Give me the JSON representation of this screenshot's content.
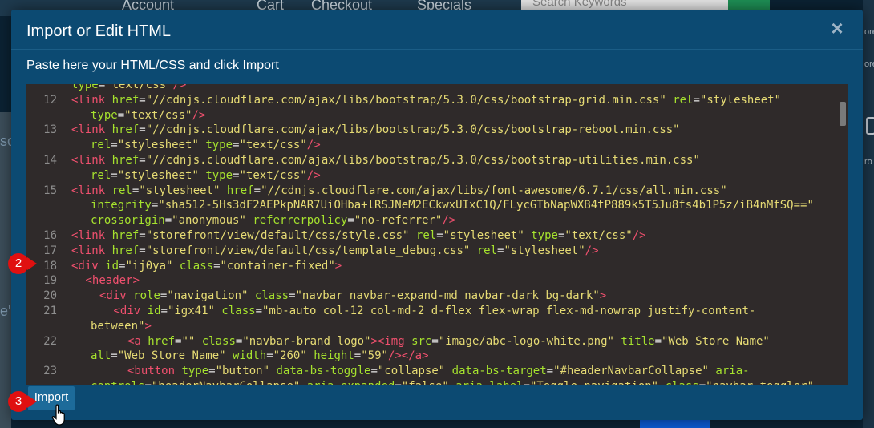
{
  "background": {
    "nav_items": [
      "Account",
      "Cart",
      "Checkout",
      "Specials"
    ],
    "search_placeholder": "Search Keywords",
    "left_fragments": [
      "sc",
      "e'"
    ],
    "right_fragments": [
      "ore",
      "ore",
      "ro"
    ]
  },
  "modal": {
    "title": "Import or Edit HTML",
    "subtitle": "Paste here your HTML/CSS and click Import",
    "close_label": "×",
    "import_label": "Import"
  },
  "steps": [
    "2",
    "3"
  ],
  "editor": {
    "lines": [
      {
        "n": "",
        "parts": [
          [
            "attr",
            "type"
          ],
          [
            "txt",
            "="
          ],
          [
            "str",
            "\"text/css\""
          ],
          [
            "tag",
            "/>"
          ]
        ]
      },
      {
        "n": "12",
        "parts": [
          [
            "tag",
            "<link "
          ],
          [
            "attr",
            "href"
          ],
          [
            "txt",
            "="
          ],
          [
            "str",
            "\"//cdnjs.cloudflare.com/ajax/libs/bootstrap/5.3.0/css/bootstrap-grid.min.css\""
          ],
          [
            "txt",
            " "
          ],
          [
            "attr",
            "rel"
          ],
          [
            "txt",
            "="
          ],
          [
            "str",
            "\"stylesheet\""
          ]
        ]
      },
      {
        "n": "",
        "cont": true,
        "parts": [
          [
            "attr",
            "type"
          ],
          [
            "txt",
            "="
          ],
          [
            "str",
            "\"text/css\""
          ],
          [
            "tag",
            "/>"
          ]
        ]
      },
      {
        "n": "13",
        "parts": [
          [
            "tag",
            "<link "
          ],
          [
            "attr",
            "href"
          ],
          [
            "txt",
            "="
          ],
          [
            "str",
            "\"//cdnjs.cloudflare.com/ajax/libs/bootstrap/5.3.0/css/bootstrap-reboot.min.css\""
          ]
        ]
      },
      {
        "n": "",
        "cont": true,
        "parts": [
          [
            "attr",
            "rel"
          ],
          [
            "txt",
            "="
          ],
          [
            "str",
            "\"stylesheet\""
          ],
          [
            "txt",
            " "
          ],
          [
            "attr",
            "type"
          ],
          [
            "txt",
            "="
          ],
          [
            "str",
            "\"text/css\""
          ],
          [
            "tag",
            "/>"
          ]
        ]
      },
      {
        "n": "14",
        "parts": [
          [
            "tag",
            "<link "
          ],
          [
            "attr",
            "href"
          ],
          [
            "txt",
            "="
          ],
          [
            "str",
            "\"//cdnjs.cloudflare.com/ajax/libs/bootstrap/5.3.0/css/bootstrap-utilities.min.css\""
          ]
        ]
      },
      {
        "n": "",
        "cont": true,
        "parts": [
          [
            "attr",
            "rel"
          ],
          [
            "txt",
            "="
          ],
          [
            "str",
            "\"stylesheet\""
          ],
          [
            "txt",
            " "
          ],
          [
            "attr",
            "type"
          ],
          [
            "txt",
            "="
          ],
          [
            "str",
            "\"text/css\""
          ],
          [
            "tag",
            "/>"
          ]
        ]
      },
      {
        "n": "15",
        "parts": [
          [
            "tag",
            "<link "
          ],
          [
            "attr",
            "rel"
          ],
          [
            "txt",
            "="
          ],
          [
            "str",
            "\"stylesheet\""
          ],
          [
            "txt",
            " "
          ],
          [
            "attr",
            "href"
          ],
          [
            "txt",
            "="
          ],
          [
            "str",
            "\"//cdnjs.cloudflare.com/ajax/libs/font-awesome/6.7.1/css/all.min.css\""
          ]
        ]
      },
      {
        "n": "",
        "cont": true,
        "parts": [
          [
            "attr",
            "integrity"
          ],
          [
            "txt",
            "="
          ],
          [
            "str",
            "\"sha512-5Hs3dF2AEPkpNAR7UiOHba+lRSJNeM2ECkwxUIxC1Q/FLycGTbNapWXB4tP889k5T5Ju8fs4b1P5z/iB4nMfSQ==\""
          ]
        ]
      },
      {
        "n": "",
        "cont": true,
        "parts": [
          [
            "attr",
            "crossorigin"
          ],
          [
            "txt",
            "="
          ],
          [
            "str",
            "\"anonymous\""
          ],
          [
            "txt",
            " "
          ],
          [
            "attr",
            "referrerpolicy"
          ],
          [
            "txt",
            "="
          ],
          [
            "str",
            "\"no-referrer\""
          ],
          [
            "tag",
            "/>"
          ]
        ]
      },
      {
        "n": "16",
        "parts": [
          [
            "tag",
            "<link "
          ],
          [
            "attr",
            "href"
          ],
          [
            "txt",
            "="
          ],
          [
            "str",
            "\"storefront/view/default/css/style.css\""
          ],
          [
            "txt",
            " "
          ],
          [
            "attr",
            "rel"
          ],
          [
            "txt",
            "="
          ],
          [
            "str",
            "\"stylesheet\""
          ],
          [
            "txt",
            " "
          ],
          [
            "attr",
            "type"
          ],
          [
            "txt",
            "="
          ],
          [
            "str",
            "\"text/css\""
          ],
          [
            "tag",
            "/>"
          ]
        ]
      },
      {
        "n": "17",
        "parts": [
          [
            "tag",
            "<link "
          ],
          [
            "attr",
            "href"
          ],
          [
            "txt",
            "="
          ],
          [
            "str",
            "\"storefront/view/default/css/template_debug.css\""
          ],
          [
            "txt",
            " "
          ],
          [
            "attr",
            "rel"
          ],
          [
            "txt",
            "="
          ],
          [
            "str",
            "\"stylesheet\""
          ],
          [
            "tag",
            "/>"
          ]
        ]
      },
      {
        "n": "18",
        "parts": [
          [
            "tag",
            "<div "
          ],
          [
            "attr",
            "id"
          ],
          [
            "txt",
            "="
          ],
          [
            "str",
            "\"ij0ya\""
          ],
          [
            "txt",
            " "
          ],
          [
            "attr",
            "class"
          ],
          [
            "txt",
            "="
          ],
          [
            "str",
            "\"container-fixed\""
          ],
          [
            "tag",
            ">"
          ]
        ]
      },
      {
        "n": "19",
        "indent": 1,
        "parts": [
          [
            "tag",
            "<header>"
          ]
        ]
      },
      {
        "n": "20",
        "indent": 2,
        "parts": [
          [
            "tag",
            "<div "
          ],
          [
            "attr",
            "role"
          ],
          [
            "txt",
            "="
          ],
          [
            "str",
            "\"navigation\""
          ],
          [
            "txt",
            " "
          ],
          [
            "attr",
            "class"
          ],
          [
            "txt",
            "="
          ],
          [
            "str",
            "\"navbar navbar-expand-md navbar-dark bg-dark\""
          ],
          [
            "tag",
            ">"
          ]
        ]
      },
      {
        "n": "21",
        "indent": 3,
        "parts": [
          [
            "tag",
            "<div "
          ],
          [
            "attr",
            "id"
          ],
          [
            "txt",
            "="
          ],
          [
            "str",
            "\"igx41\""
          ],
          [
            "txt",
            " "
          ],
          [
            "attr",
            "class"
          ],
          [
            "txt",
            "="
          ],
          [
            "str",
            "\"mb-auto col-12 col-md-2 d-flex flex-wrap flex-md-nowrap justify-content-"
          ]
        ]
      },
      {
        "n": "",
        "cont": true,
        "parts": [
          [
            "str",
            "between\""
          ],
          [
            "tag",
            ">"
          ]
        ]
      },
      {
        "n": "22",
        "indent": 4,
        "parts": [
          [
            "tag",
            "<a "
          ],
          [
            "attr",
            "href"
          ],
          [
            "txt",
            "="
          ],
          [
            "str",
            "\"\""
          ],
          [
            "txt",
            " "
          ],
          [
            "attr",
            "class"
          ],
          [
            "txt",
            "="
          ],
          [
            "str",
            "\"navbar-brand logo\""
          ],
          [
            "tag",
            "><img "
          ],
          [
            "attr",
            "src"
          ],
          [
            "txt",
            "="
          ],
          [
            "str",
            "\"image/abc-logo-white.png\""
          ],
          [
            "txt",
            " "
          ],
          [
            "attr",
            "title"
          ],
          [
            "txt",
            "="
          ],
          [
            "str",
            "\"Web Store Name\""
          ]
        ]
      },
      {
        "n": "",
        "cont": true,
        "parts": [
          [
            "attr",
            "alt"
          ],
          [
            "txt",
            "="
          ],
          [
            "str",
            "\"Web Store Name\""
          ],
          [
            "txt",
            " "
          ],
          [
            "attr",
            "width"
          ],
          [
            "txt",
            "="
          ],
          [
            "str",
            "\"260\""
          ],
          [
            "txt",
            " "
          ],
          [
            "attr",
            "height"
          ],
          [
            "txt",
            "="
          ],
          [
            "str",
            "\"59\""
          ],
          [
            "tag",
            "/></a>"
          ]
        ]
      },
      {
        "n": "23",
        "indent": 4,
        "parts": [
          [
            "tag",
            "<button "
          ],
          [
            "attr",
            "type"
          ],
          [
            "txt",
            "="
          ],
          [
            "str",
            "\"button\""
          ],
          [
            "txt",
            " "
          ],
          [
            "attr",
            "data-bs-toggle"
          ],
          [
            "txt",
            "="
          ],
          [
            "str",
            "\"collapse\""
          ],
          [
            "txt",
            " "
          ],
          [
            "attr",
            "data-bs-target"
          ],
          [
            "txt",
            "="
          ],
          [
            "str",
            "\"#headerNavbarCollapse\""
          ],
          [
            "txt",
            " "
          ],
          [
            "attr",
            "aria-"
          ]
        ]
      },
      {
        "n": "",
        "cont": true,
        "parts": [
          [
            "attr",
            "controls"
          ],
          [
            "txt",
            "="
          ],
          [
            "str",
            "\"headerNavbarCollapse\""
          ],
          [
            "txt",
            " "
          ],
          [
            "attr",
            "aria-expanded"
          ],
          [
            "txt",
            "="
          ],
          [
            "str",
            "\"false\""
          ],
          [
            "txt",
            " "
          ],
          [
            "attr",
            "aria-label"
          ],
          [
            "txt",
            "="
          ],
          [
            "str",
            "\"Toggle navigation\""
          ],
          [
            "txt",
            " "
          ],
          [
            "attr",
            "class"
          ],
          [
            "txt",
            "="
          ],
          [
            "str",
            "\"navbar-toggler\""
          ]
        ]
      }
    ]
  }
}
